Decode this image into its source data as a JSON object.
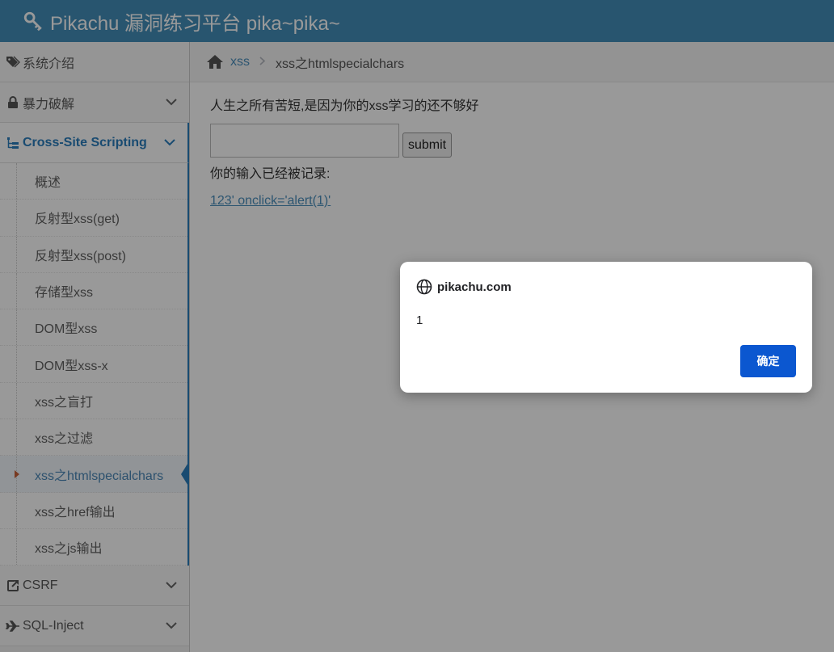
{
  "navbar": {
    "title": "Pikachu 漏洞练习平台 pika~pika~"
  },
  "sidebar": {
    "items": [
      {
        "label": "系统介绍"
      },
      {
        "label": "暴力破解"
      },
      {
        "label": "Cross-Site Scripting"
      },
      {
        "label": "CSRF"
      },
      {
        "label": "SQL-Inject"
      }
    ],
    "xss_sub": [
      {
        "label": "概述"
      },
      {
        "label": "反射型xss(get)"
      },
      {
        "label": "反射型xss(post)"
      },
      {
        "label": "存储型xss"
      },
      {
        "label": "DOM型xss"
      },
      {
        "label": "DOM型xss-x"
      },
      {
        "label": "xss之盲打"
      },
      {
        "label": "xss之过滤"
      },
      {
        "label": "xss之htmlspecialchars"
      },
      {
        "label": "xss之href输出"
      },
      {
        "label": "xss之js输出"
      }
    ]
  },
  "breadcrumb": {
    "link": "xss",
    "current": "xss之htmlspecialchars"
  },
  "content": {
    "intro": "人生之所有苦短,是因为你的xss学习的还不够好",
    "input_value": "",
    "submit_label": "submit",
    "recorded_label": "你的输入已经被记录:",
    "record_link": "123' onclick='alert(1)'"
  },
  "dialog": {
    "site": "pikachu.com",
    "message": "1",
    "ok_label": "确定"
  },
  "colors": {
    "navbar": "#438eb9",
    "accent": "#2b7dbc",
    "dialog_button": "#0b57d0"
  }
}
